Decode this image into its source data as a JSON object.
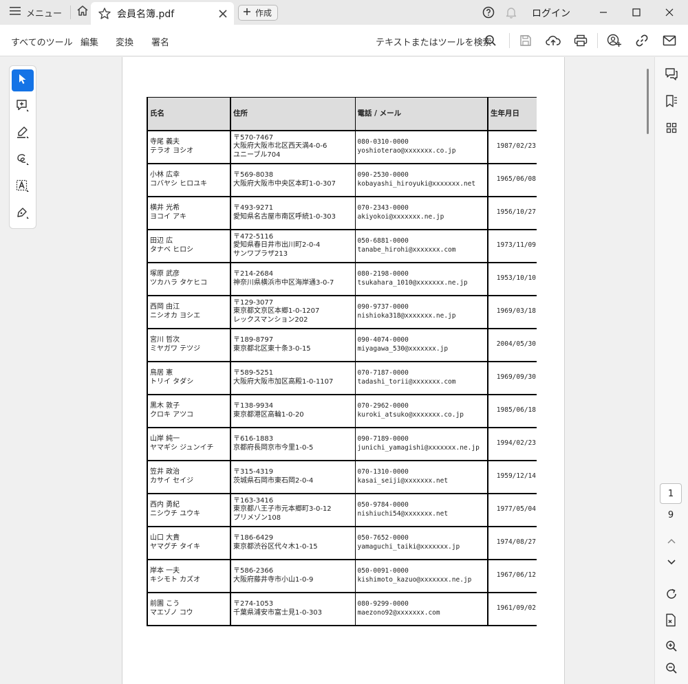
{
  "titlebar": {
    "menu_label": "メニュー",
    "tab_title": "会員名簿.pdf",
    "create_label": "作成",
    "login_label": "ログイン"
  },
  "menubar": {
    "items": [
      "すべてのツール",
      "編集",
      "変換",
      "署名"
    ],
    "search_label": "テキストまたはツールを検索"
  },
  "pager": {
    "current": "1",
    "total": "9"
  },
  "table": {
    "headers": [
      "氏名",
      "住所",
      "電話 / メール",
      "生年月日"
    ],
    "rows": [
      {
        "name": [
          "寺尾 義夫",
          "テラオ ヨシオ"
        ],
        "address": [
          "〒570-7467",
          "大阪府大阪市北区西天満4-0-6",
          "ユニーブル704"
        ],
        "contact": [
          "080-0310-0000",
          "yoshioterao@xxxxxxx.co.jp"
        ],
        "dob": "1987/02/23"
      },
      {
        "name": [
          "小林 広幸",
          "コバヤシ ヒロユキ"
        ],
        "address": [
          "〒569-8038",
          "大阪府大阪市中央区本町1-0-307"
        ],
        "contact": [
          "090-2530-0000",
          "kobayashi_hiroyuki@xxxxxxx.net"
        ],
        "dob": "1965/06/08"
      },
      {
        "name": [
          "横井 光希",
          "ヨコイ アキ"
        ],
        "address": [
          "〒493-9271",
          "愛知県名古屋市南区呼続1-0-303"
        ],
        "contact": [
          "070-2343-0000",
          "akiyokoi@xxxxxxx.ne.jp"
        ],
        "dob": "1956/10/27"
      },
      {
        "name": [
          "田辺 広",
          "タナベ ヒロシ"
        ],
        "address": [
          "〒472-5116",
          "愛知県春日井市出川町2-0-4",
          "サンワプラザ213"
        ],
        "contact": [
          "050-6881-0000",
          "tanabe_hirohi@xxxxxxx.com"
        ],
        "dob": "1973/11/09"
      },
      {
        "name": [
          "塚原 武彦",
          "ツカハラ タケヒコ"
        ],
        "address": [
          "〒214-2684",
          "神奈川県横浜市中区海岸通3-0-7"
        ],
        "contact": [
          "080-2198-0000",
          "tsukahara_1010@xxxxxxx.ne.jp"
        ],
        "dob": "1953/10/10"
      },
      {
        "name": [
          "西岡 由江",
          "ニシオカ ヨシエ"
        ],
        "address": [
          "〒129-3077",
          "東京都文京区本郷1-0-1207",
          "レックスマンション202"
        ],
        "contact": [
          "090-9737-0000",
          "nishioka318@xxxxxxx.ne.jp"
        ],
        "dob": "1969/03/18"
      },
      {
        "name": [
          "宮川 哲次",
          "ミヤガワ テツジ"
        ],
        "address": [
          "〒189-8797",
          "東京都北区東十条3-0-15"
        ],
        "contact": [
          "090-4074-0000",
          "miyagawa_530@xxxxxxx.jp"
        ],
        "dob": "2004/05/30"
      },
      {
        "name": [
          "鳥居 憲",
          "トリイ タダシ"
        ],
        "address": [
          "〒589-5251",
          "大阪府大阪市加区高殿1-0-1107"
        ],
        "contact": [
          "070-7187-0000",
          "tadashi_torii@xxxxxxx.com"
        ],
        "dob": "1969/09/30"
      },
      {
        "name": [
          "黒木 敦子",
          "クロキ アツコ"
        ],
        "address": [
          "〒138-9934",
          "東京都港区高輪1-0-20"
        ],
        "contact": [
          "070-2962-0000",
          "kuroki_atsuko@xxxxxxx.co.jp"
        ],
        "dob": "1985/06/18"
      },
      {
        "name": [
          "山岸 純一",
          "ヤマギシ ジュンイチ"
        ],
        "address": [
          "〒616-1883",
          "京都府長岡京市今里1-0-5"
        ],
        "contact": [
          "090-7189-0000",
          "junichi_yamagishi@xxxxxxx.ne.jp"
        ],
        "dob": "1994/02/23"
      },
      {
        "name": [
          "笠井 政治",
          "カサイ セイジ"
        ],
        "address": [
          "〒315-4319",
          "茨城県石岡市東石岡2-0-4"
        ],
        "contact": [
          "070-1310-0000",
          "kasai_seiji@xxxxxxx.net"
        ],
        "dob": "1959/12/14"
      },
      {
        "name": [
          "西内 勇紀",
          "ニシウチ ユウキ"
        ],
        "address": [
          "〒163-3416",
          "東京都八王子市元本郷町3-0-12",
          "プリメゾン108"
        ],
        "contact": [
          "050-9784-0000",
          "nishiuchi54@xxxxxxx.net"
        ],
        "dob": "1977/05/04"
      },
      {
        "name": [
          "山口 大貴",
          "ヤマグチ タイキ"
        ],
        "address": [
          "〒186-6429",
          "東京都渋谷区代々木1-0-15"
        ],
        "contact": [
          "050-7652-0000",
          "yamaguchi_taiki@xxxxxxx.jp"
        ],
        "dob": "1974/08/27"
      },
      {
        "name": [
          "岸本 一夫",
          "キシモト カズオ"
        ],
        "address": [
          "〒586-2366",
          "大阪府藤井寺市小山1-0-9"
        ],
        "contact": [
          "050-0091-0000",
          "kishimoto_kazuo@xxxxxxx.ne.jp"
        ],
        "dob": "1967/06/12"
      },
      {
        "name": [
          "前園 こう",
          "マエゾノ コウ"
        ],
        "address": [
          "〒274-1053",
          "千葉県浦安市富士見1-0-303"
        ],
        "contact": [
          "080-9299-0000",
          "maezono92@xxxxxxx.com"
        ],
        "dob": "1961/09/02"
      }
    ]
  }
}
